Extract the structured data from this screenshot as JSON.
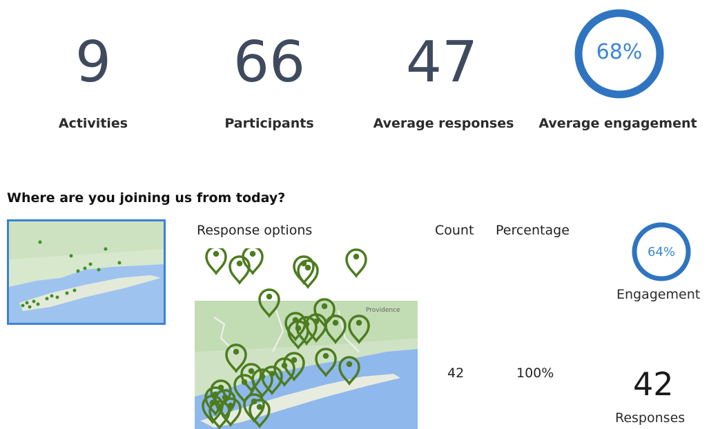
{
  "stats": [
    {
      "value": "9",
      "label": "Activities"
    },
    {
      "value": "66",
      "label": "Participants"
    },
    {
      "value": "47",
      "label": "Average responses"
    }
  ],
  "engagement": {
    "value": "68%",
    "fraction": 0.68,
    "label": "Average engagement"
  },
  "question": {
    "title": "Where are you joining us from today?",
    "columns": {
      "options": "Response options",
      "count": "Count",
      "percentage": "Percentage"
    },
    "row": {
      "count": "42",
      "percentage": "100%"
    },
    "engagement_value": "64%",
    "engagement_fraction": 0.64,
    "engagement_label": "Engagement",
    "responses_value": "42",
    "responses_label": "Responses"
  },
  "map_labels": {
    "providence": "Providence"
  },
  "icons": {
    "map_pin": "map-pin-icon"
  },
  "colors": {
    "ring": "#2f74c0",
    "ring_text": "#3a86d4",
    "pin": "#4d7c1f",
    "water": "#8fb8ec",
    "land": "#cfe3c4"
  }
}
